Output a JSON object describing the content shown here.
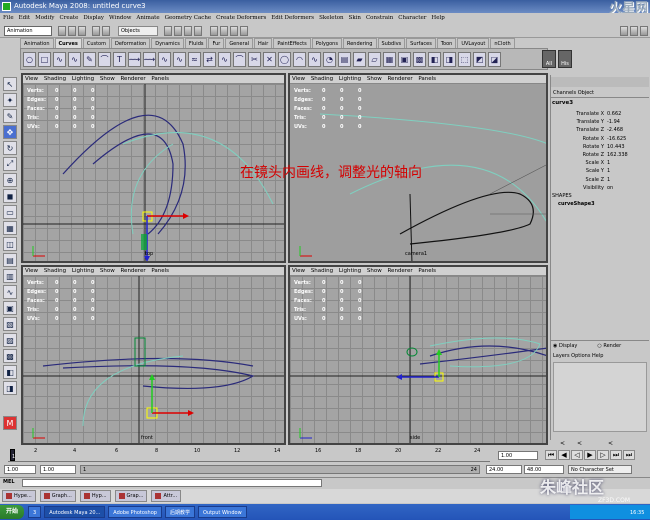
{
  "window": {
    "title": "Autodesk Maya 2008: untitled    curve3",
    "logo": "火星网"
  },
  "menubar": [
    "File",
    "Edit",
    "Modify",
    "Create",
    "Display",
    "Window",
    "Animate",
    "Geometry Cache",
    "Create Deformers",
    "Edit Deformers",
    "Skeleton",
    "Skin",
    "Constrain",
    "Character",
    "Help"
  ],
  "statusline": {
    "mode": "Animation",
    "objects": "Objects"
  },
  "shelf_tabs": [
    "Animation",
    "Curves",
    "Custom",
    "Deformation",
    "Dynamics",
    "Fluids",
    "Fur",
    "General",
    "Hair",
    "PaintEffects",
    "Polygons",
    "Rendering",
    "Subdivs",
    "Surfaces",
    "Toon",
    "UVLayout",
    "nCloth"
  ],
  "shelf_tabs_active": "Curves",
  "shelf_all": "All",
  "shelf_his": "His",
  "viewport_menu": [
    "View",
    "Shading",
    "Lighting",
    "Show",
    "Renderer",
    "Panels"
  ],
  "hud": {
    "labels": [
      "Verts:",
      "Edges:",
      "Faces:",
      "Tris:",
      "UVs:"
    ],
    "values": [
      [
        "0",
        "0",
        "0"
      ],
      [
        "0",
        "0",
        "0"
      ],
      [
        "0",
        "0",
        "0"
      ],
      [
        "0",
        "0",
        "0"
      ],
      [
        "0",
        "0",
        "0"
      ]
    ]
  },
  "viewports": {
    "top_left_cam": "top",
    "top_right_cam": "camera1",
    "bottom_left_cam": "front",
    "bottom_right_cam": "side"
  },
  "overlay_text": "在镜头内画线，调整光的轴向",
  "channelbox": {
    "tabs": "Channels  Object",
    "object": "curve3",
    "attrs": [
      {
        "k": "Translate X",
        "v": "0.662"
      },
      {
        "k": "Translate Y",
        "v": "-1.94"
      },
      {
        "k": "Translate Z",
        "v": "-2.468"
      },
      {
        "k": "Rotate X",
        "v": "-16.625"
      },
      {
        "k": "Rotate Y",
        "v": "10.443"
      },
      {
        "k": "Rotate Z",
        "v": "162.338"
      },
      {
        "k": "Scale X",
        "v": "1"
      },
      {
        "k": "Scale Y",
        "v": "1"
      },
      {
        "k": "Scale Z",
        "v": "1"
      },
      {
        "k": "Visibility",
        "v": "on"
      }
    ],
    "shapes_label": "SHAPES",
    "shape_name": "curveShape3"
  },
  "layers": {
    "display": "Display",
    "render": "Render",
    "menu": "Layers  Options  Help",
    "arrows": "<< <"
  },
  "timeline": {
    "ticks": [
      "2",
      "4",
      "6",
      "8",
      "10",
      "12",
      "14",
      "16",
      "18",
      "20",
      "22",
      "24"
    ],
    "current": "1",
    "end_field": "1.00"
  },
  "range": {
    "start": "1.00",
    "start2": "1.00",
    "start3": "1",
    "end": "24",
    "anim_end": "24.00",
    "anim_end2": "48.00",
    "character": "No Character Set"
  },
  "mel": {
    "label": "MEL"
  },
  "minimized": [
    "Hype...",
    "Graph...",
    "Hyp...",
    "Grap...",
    "Attr..."
  ],
  "taskbar": {
    "start": "开始",
    "items": [
      "3",
      "Autodesk Maya 20...",
      "Adobe Photoshop",
      "后期教学",
      "Output Window"
    ],
    "time": "16:35"
  },
  "watermark": {
    "main": "朱峰社区",
    "sub": "ZF3D.COM"
  }
}
